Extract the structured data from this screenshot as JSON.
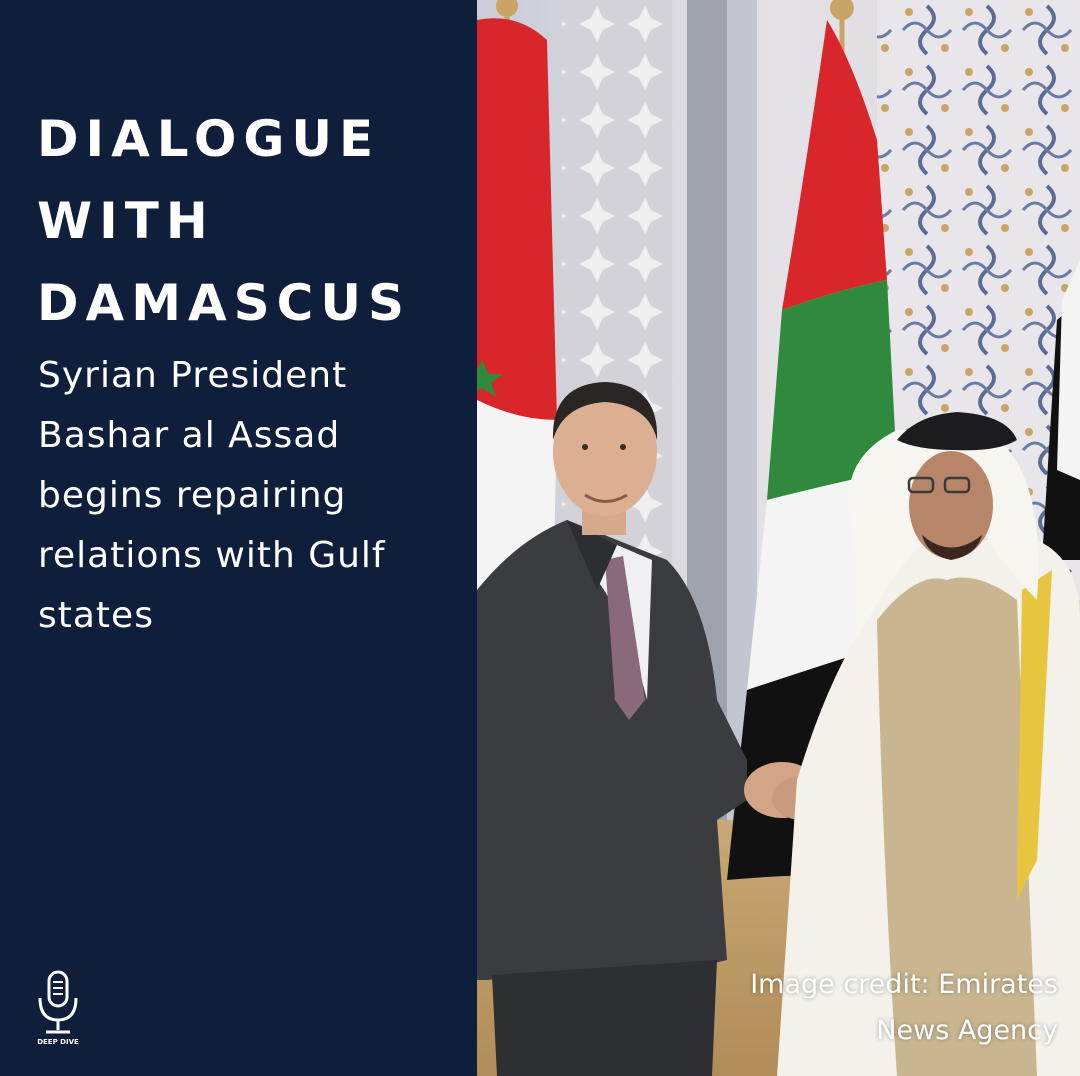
{
  "headline": {
    "line1": "DIALOGUE",
    "line2": "WITH",
    "line3": "DAMASCUS"
  },
  "subheadline": "Syrian President Bashar al Assad begins repairing relations with Gulf states",
  "credit": {
    "line1": "Image credit: Emirates",
    "line2": "News Agency"
  },
  "logo": {
    "icon": "microphone-icon",
    "text": "DEEP DIVE"
  },
  "colors": {
    "panel_background": "#0f1e3a",
    "text": "#ffffff",
    "flag_red": "#d8262b",
    "flag_green": "#2f8a3e",
    "flag_black": "#111111"
  }
}
